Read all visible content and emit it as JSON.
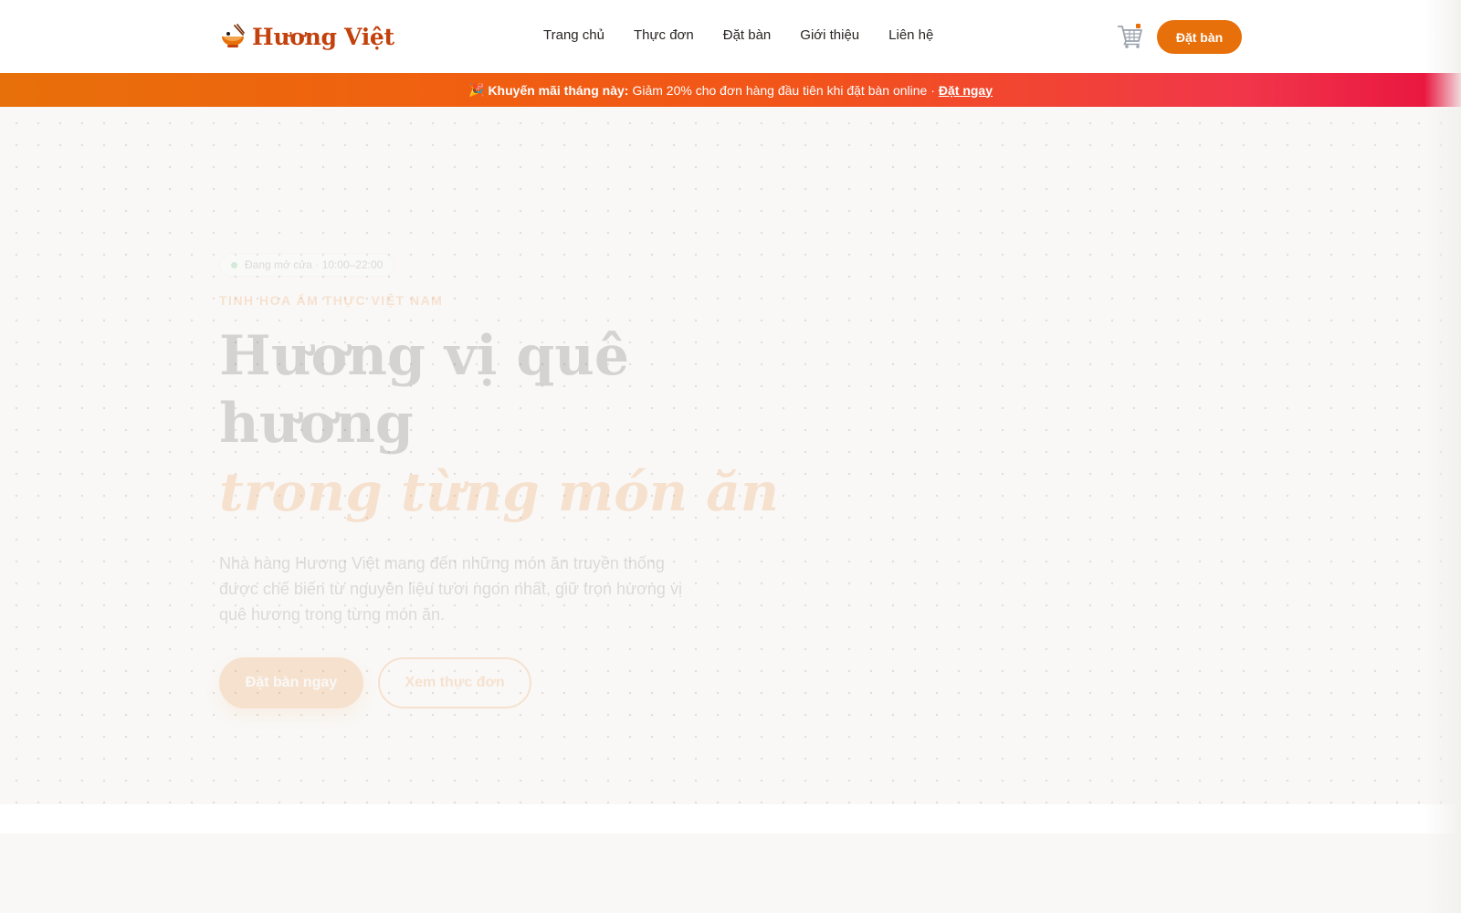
{
  "header": {
    "logo_text": "Hương Việt",
    "logo_icon": "noodle-bowl-icon",
    "nav": [
      {
        "label": "Trang chủ"
      },
      {
        "label": "Thực đơn"
      },
      {
        "label": "Đặt bàn"
      },
      {
        "label": "Giới thiệu"
      },
      {
        "label": "Liên hệ"
      }
    ],
    "cart_icon": "cart-icon",
    "cta_label": "Đặt bàn"
  },
  "promo": {
    "emoji": "🎉",
    "bold_text": "Khuyến mãi tháng này:",
    "text": "Giảm 20% cho đơn hàng đầu tiên khi đặt bàn online ·",
    "link_text": "Đặt ngay"
  },
  "hero": {
    "badge_text": "Đang mở cửa · 10:00–22:00",
    "eyebrow": "TINH HOA ẨM THỰC VIỆT NAM",
    "headline": "Hương vị quê hương",
    "headline_accent": "trong từng món ăn",
    "description": "Nhà hàng Hương Việt mang đến những món ăn truyền thống được chế biến từ nguyên liệu tươi ngon nhất, giữ trọn hương vị quê hương trong từng món ăn.",
    "primary_button": "Đặt bàn ngay",
    "secondary_button": "Xem thực đơn"
  },
  "colors": {
    "accent": "#e8700a",
    "brand_text": "#c2410c",
    "promo_end": "#e8123e"
  }
}
